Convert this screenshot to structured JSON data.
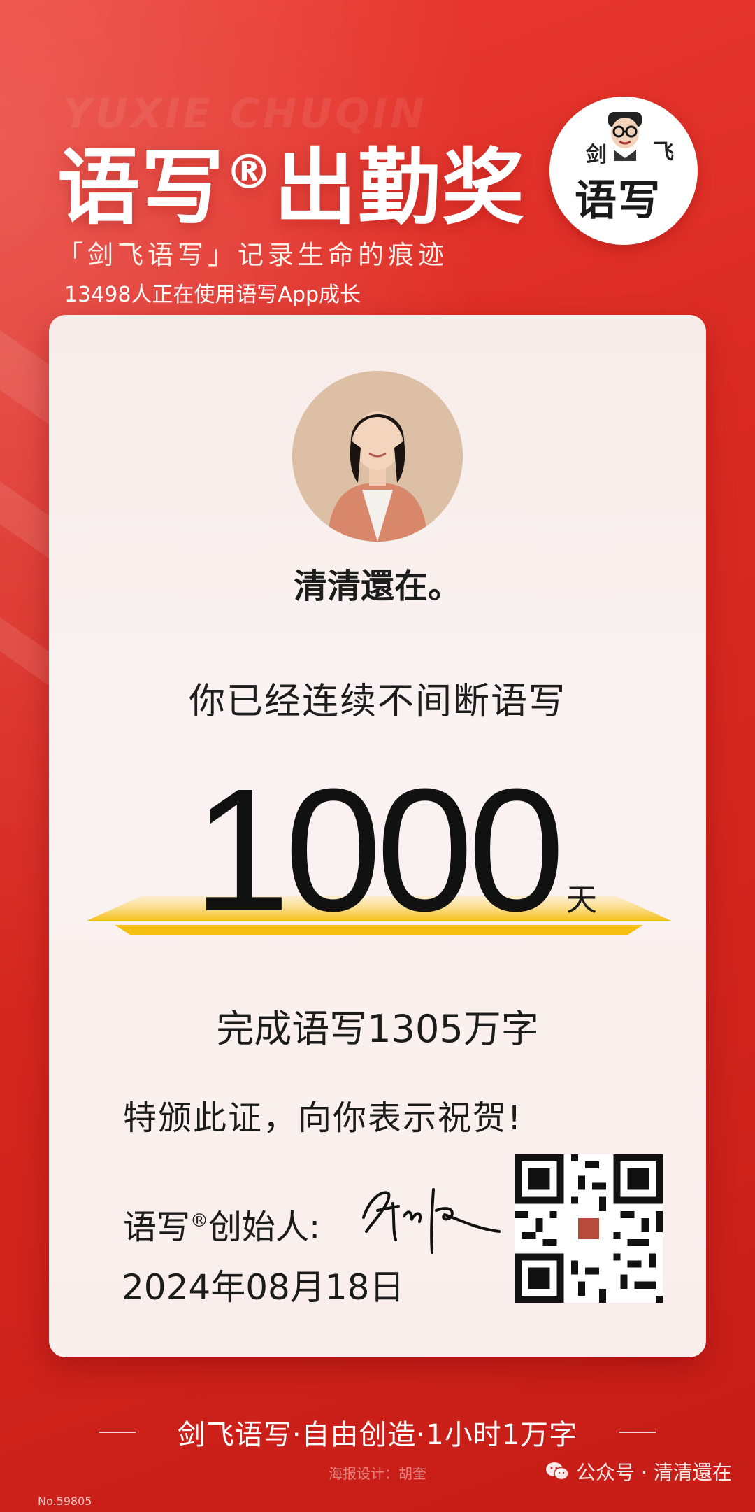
{
  "header": {
    "bg_text": "YUXIE CHUQIN",
    "title_main": "语写",
    "title_reg": "®",
    "title_tail": "出勤奖",
    "slogan": "「剑飞语写」记录生命的痕迹",
    "users_line": "13498人正在使用语写App成长",
    "logo": {
      "char_left": "剑",
      "char_right": "飞",
      "big": "语写"
    }
  },
  "certificate": {
    "name": "清清還在。",
    "streak_text": "你已经连续不间断语写",
    "days_number": "1000",
    "days_unit": "天",
    "words_text": "完成语写1305万字",
    "congrats_text": "特颁此证，向你表示祝贺!",
    "founder_a": "语写",
    "founder_reg": "®",
    "founder_b": "创始人:",
    "date": "2024年08月18日"
  },
  "footer": {
    "tagline": "剑飞语写·自由创造·1小时1万字",
    "designer": "海报设计：胡奎",
    "watermark": "公众号 · 清清還在",
    "serial": "No.59805"
  },
  "colors": {
    "background": "#d8261e",
    "card": "#f8efed",
    "accent_gold": "#f6c21a",
    "text_dark": "#1b1b1b"
  }
}
